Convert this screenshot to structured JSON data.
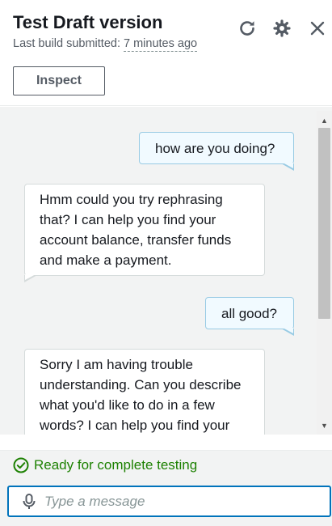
{
  "header": {
    "title": "Test Draft version",
    "subtitle_prefix": "Last build submitted:",
    "build_age": "7 minutes ago",
    "inspect_label": "Inspect"
  },
  "messages": [
    {
      "role": "user",
      "text": "how are you doing?"
    },
    {
      "role": "bot",
      "text": "Hmm could you try rephrasing that? I can help you find your account balance, transfer funds and make a payment."
    },
    {
      "role": "user",
      "text": "all good?"
    },
    {
      "role": "bot",
      "text": "Sorry I am having trouble understanding. Can you describe what you'd like to do in a few words? I can help you find your"
    }
  ],
  "status": {
    "text": "Ready for complete testing",
    "color": "#1d8102"
  },
  "composer": {
    "placeholder": "Type a message",
    "accent": "#0073bb"
  },
  "icons": [
    "refresh-icon",
    "gear-icon",
    "close-icon",
    "check-circle-icon",
    "microphone-icon"
  ]
}
